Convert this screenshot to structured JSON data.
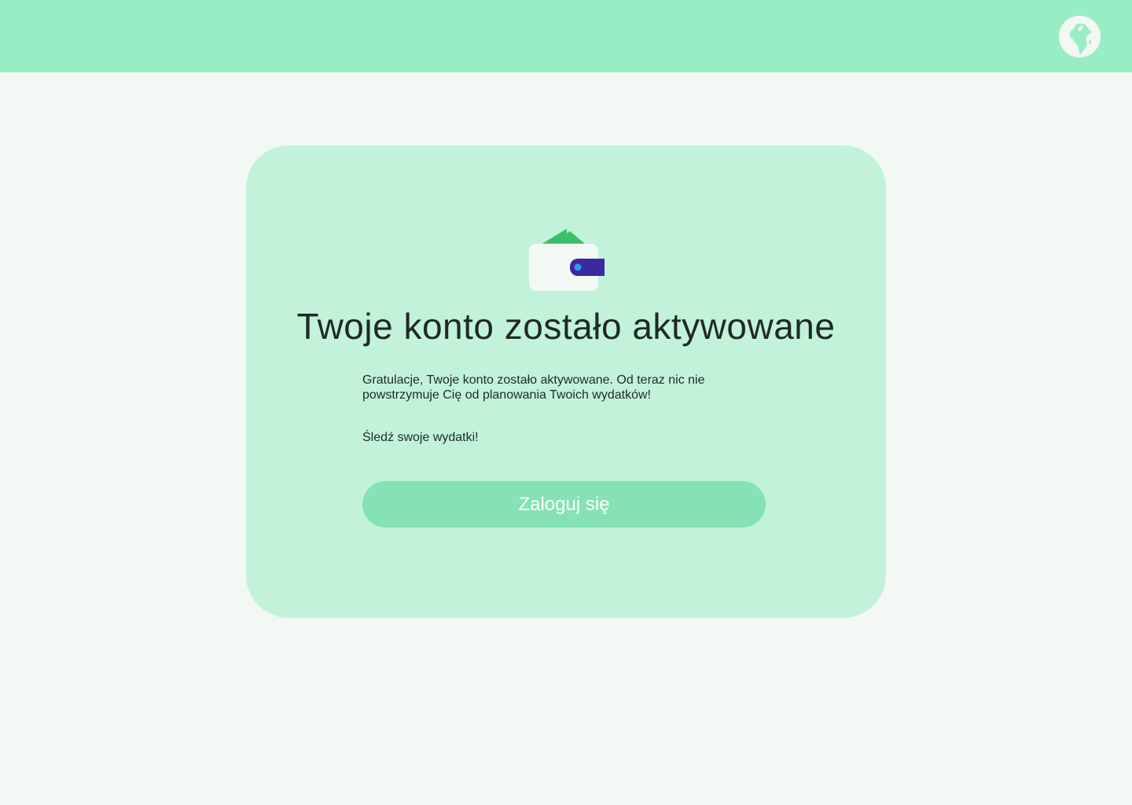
{
  "header": {
    "language_icon": "globe-icon"
  },
  "card": {
    "illustration_icon": "wallet-icon",
    "title": "Twoje konto zostało aktywowane",
    "description": "Gratulacje, Twoje konto zostało aktywowane. Od teraz nic nie powstrzymuje Cię od planowania Twoich wydatków!",
    "tagline": "Śledź swoje wydatki!",
    "login_label": "Zaloguj się"
  },
  "colors": {
    "header_bg": "#99EDC5",
    "page_bg": "#F3F8F4",
    "card_bg": "#C3F2DB",
    "button_bg": "#84E2B5",
    "wallet_money": "#3DBE6B",
    "wallet_clasp": "#3B2A9E",
    "wallet_dot": "#2E9BF0"
  }
}
